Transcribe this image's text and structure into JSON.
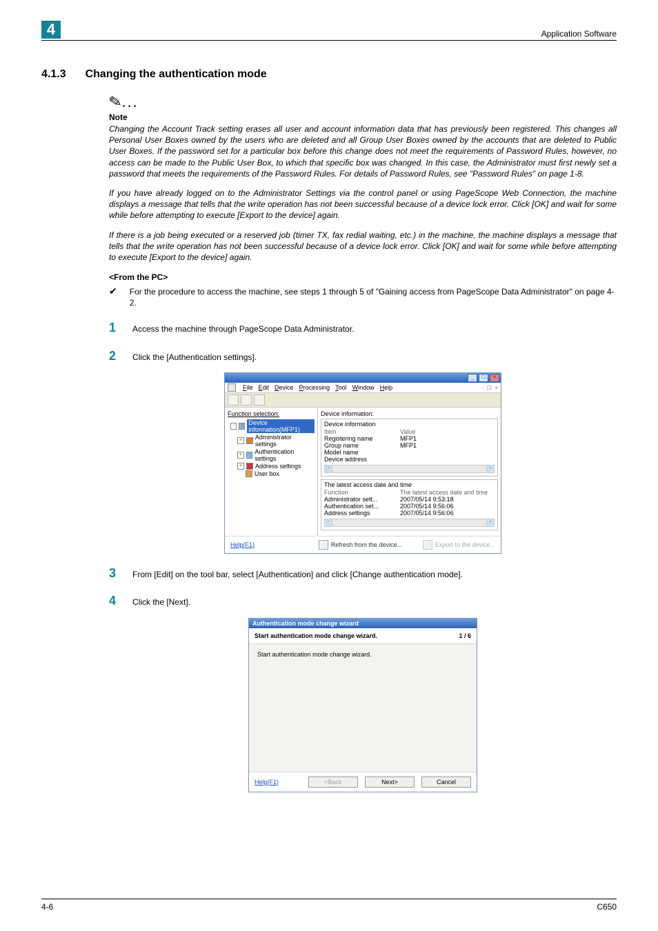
{
  "header": {
    "chapter_number": "4",
    "right_label": "Application Software"
  },
  "section": {
    "number": "4.1.3",
    "title": "Changing the authentication mode"
  },
  "note": {
    "label": "Note",
    "para1": "Changing the Account Track setting erases all user and account information data that has previously been registered. This changes all Personal User Boxes owned by the users who are deleted and all Group User Boxes owned by the accounts that are deleted to Public User Boxes. If the password set for a particular box before this change does not meet the requirements of Password Rules, however, no access can be made to the Public User Box, to which that specific box was changed. In this case, the Administrator must first newly set a password that meets the requirements of the Password Rules. For details of Password Rules, see \"Password Rules\" on page 1-8.",
    "para2": "If you have already logged on to the Administrator Settings via the control panel or using PageScope Web Connection, the machine displays a message that tells that the write operation has not been successful because of a device lock error. Click [OK] and wait for some while before attempting to execute [Export to the device] again.",
    "para3": "If there is a job being executed or a reserved job (timer TX, fax redial waiting, etc.) in the machine, the machine displays a message that tells that the write operation has not been successful because of a device lock error. Click [OK] and wait for some while before attempting to execute [Export to the device] again."
  },
  "subhead": "<From the PC>",
  "check_item": "For the procedure to access the machine, see steps 1 through 5 of \"Gaining access from PageScope Data Administrator\" on page 4-2.",
  "steps": {
    "s1": "Access the machine through PageScope Data Administrator.",
    "s2": "Click the [Authentication settings].",
    "s3": "From [Edit] on the tool bar, select [Authentication] and click [Change authentication mode].",
    "s4": "Click the [Next]."
  },
  "screenshot1": {
    "menubar_items": [
      "File",
      "Edit",
      "Device",
      "Processing",
      "Tool",
      "Window",
      "Help"
    ],
    "tree_title": "Function selection:",
    "tree_root": "Device information(MFP1)",
    "tree_items": [
      "Administrator settings",
      "Authentication settings",
      "Address settings",
      "User box"
    ],
    "pane_title": "Device information:",
    "group1_title": "Device information",
    "kv_header_k": "Item",
    "kv_header_v": "Value",
    "kv": [
      {
        "k": "Registering name",
        "v": "MFP1"
      },
      {
        "k": "Group name",
        "v": "MFP1"
      },
      {
        "k": "Model name",
        "v": ""
      },
      {
        "k": "Device address",
        "v": ""
      }
    ],
    "group2_title": "The latest access date and time",
    "kv2_header_k": "Function",
    "kv2_header_v": "The latest access date and time",
    "kv2": [
      {
        "k": "Administrator sett...",
        "v": "2007/05/14 9:53:18"
      },
      {
        "k": "Authentication set...",
        "v": "2007/05/14 9:56:06"
      },
      {
        "k": "Address settings",
        "v": "2007/05/14 9:56:06"
      }
    ],
    "help": "Help(F1)",
    "btn_refresh": "Refresh from the device...",
    "btn_export": "Export to the device..."
  },
  "screenshot2": {
    "title": "Authentication mode change wizard",
    "head_left": "Start authentication mode change wizard.",
    "head_right": "1 / 6",
    "body_text": "Start authentication mode change wizard.",
    "help": "Help(F1)",
    "btn_back": "<Back",
    "btn_next": "Next>",
    "btn_cancel": "Cancel"
  },
  "footer": {
    "left": "4-6",
    "right": "C650"
  }
}
